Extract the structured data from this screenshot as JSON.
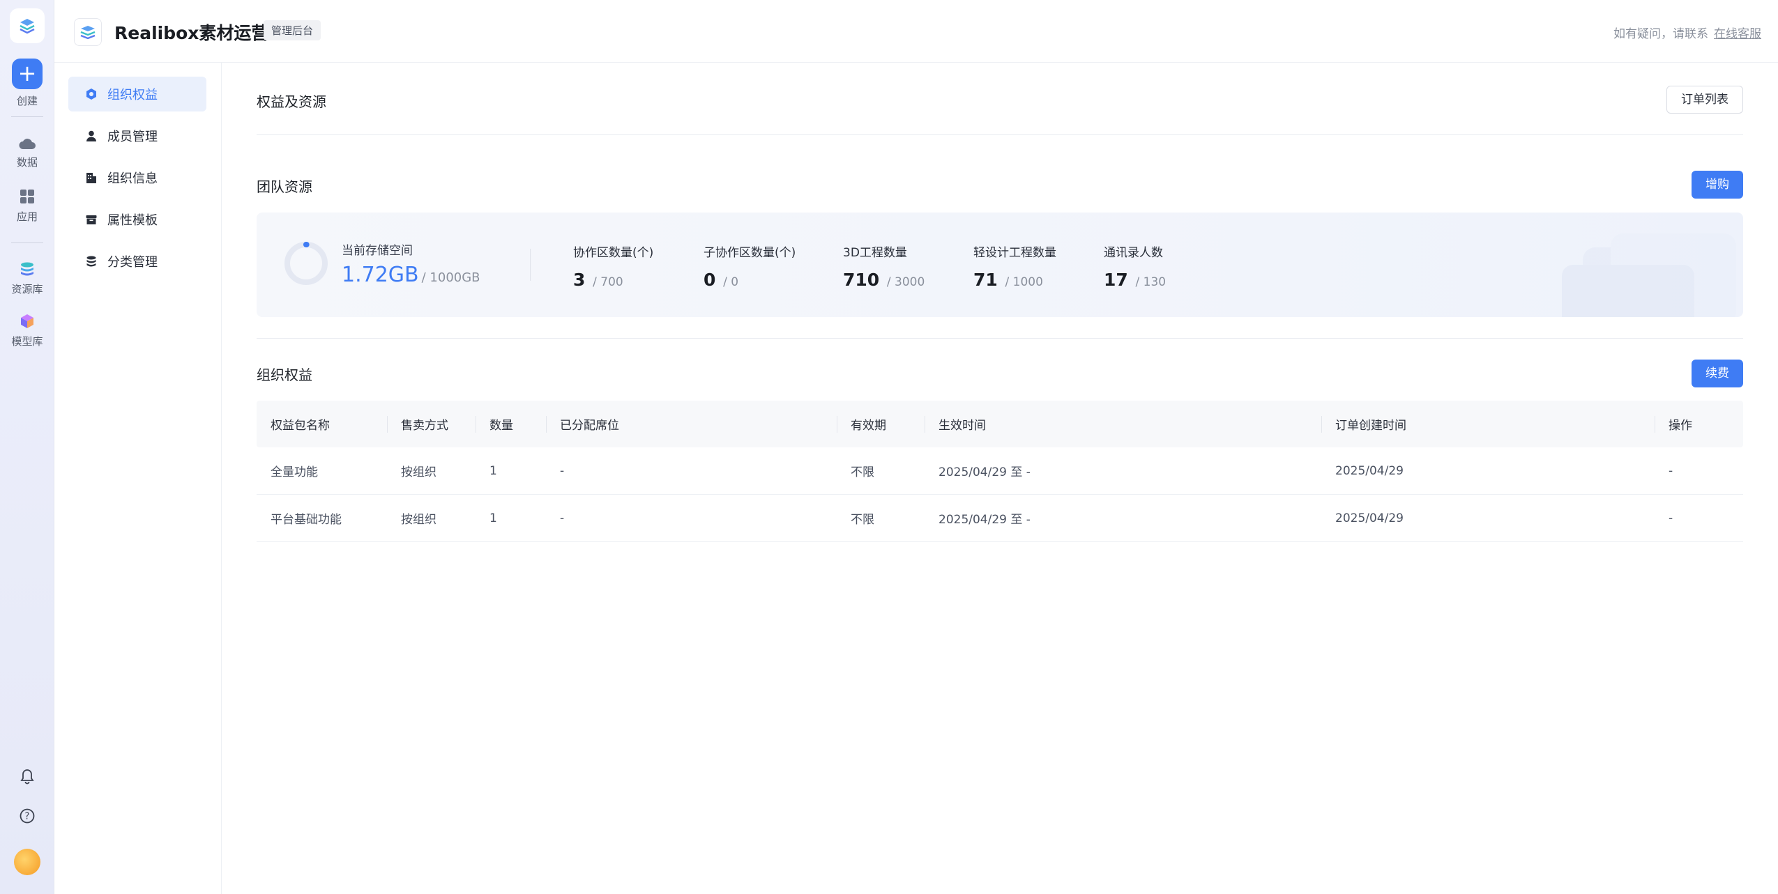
{
  "rail": {
    "create": "创建",
    "data": "数据",
    "apps": "应用",
    "resources": "资源库",
    "models": "模型库"
  },
  "header": {
    "title": "Realibox素材运营",
    "tag": "管理后台",
    "help_text": "如有疑问，请联系",
    "help_link": "在线客服"
  },
  "subnav": {
    "items": [
      {
        "label": "组织权益"
      },
      {
        "label": "成员管理"
      },
      {
        "label": "组织信息"
      },
      {
        "label": "属性模板"
      },
      {
        "label": "分类管理"
      }
    ]
  },
  "main": {
    "section1_title": "权益及资源",
    "order_list_button": "订单列表",
    "team_title": "团队资源",
    "buy_button": "增购",
    "storage": {
      "label": "当前存储空间",
      "value": "1.72GB",
      "total": "/ 1000GB",
      "used_fraction": 0.00172
    },
    "stats": [
      {
        "label": "协作区数量(个)",
        "value": "3",
        "total": "/ 700"
      },
      {
        "label": "子协作区数量(个)",
        "value": "0",
        "total": "/ 0"
      },
      {
        "label": "3D工程数量",
        "value": "710",
        "total": "/ 3000"
      },
      {
        "label": "轻设计工程数量",
        "value": "71",
        "total": "/ 1000"
      },
      {
        "label": "通讯录人数",
        "value": "17",
        "total": "/ 130"
      }
    ],
    "rights_title": "组织权益",
    "renew_button": "续费",
    "table": {
      "headers": [
        "权益包名称",
        "售卖方式",
        "数量",
        "已分配席位",
        "有效期",
        "生效时间",
        "订单创建时间",
        "操作"
      ],
      "rows": [
        [
          "全量功能",
          "按组织",
          "1",
          "-",
          "不限",
          "2025/04/29 至 -",
          "2025/04/29",
          "-"
        ],
        [
          "平台基础功能",
          "按组织",
          "1",
          "-",
          "不限",
          "2025/04/29 至 -",
          "2025/04/29",
          "-"
        ]
      ]
    }
  },
  "colors": {
    "accent": "#3f7cf4",
    "active_bg": "#eaf0fc"
  }
}
